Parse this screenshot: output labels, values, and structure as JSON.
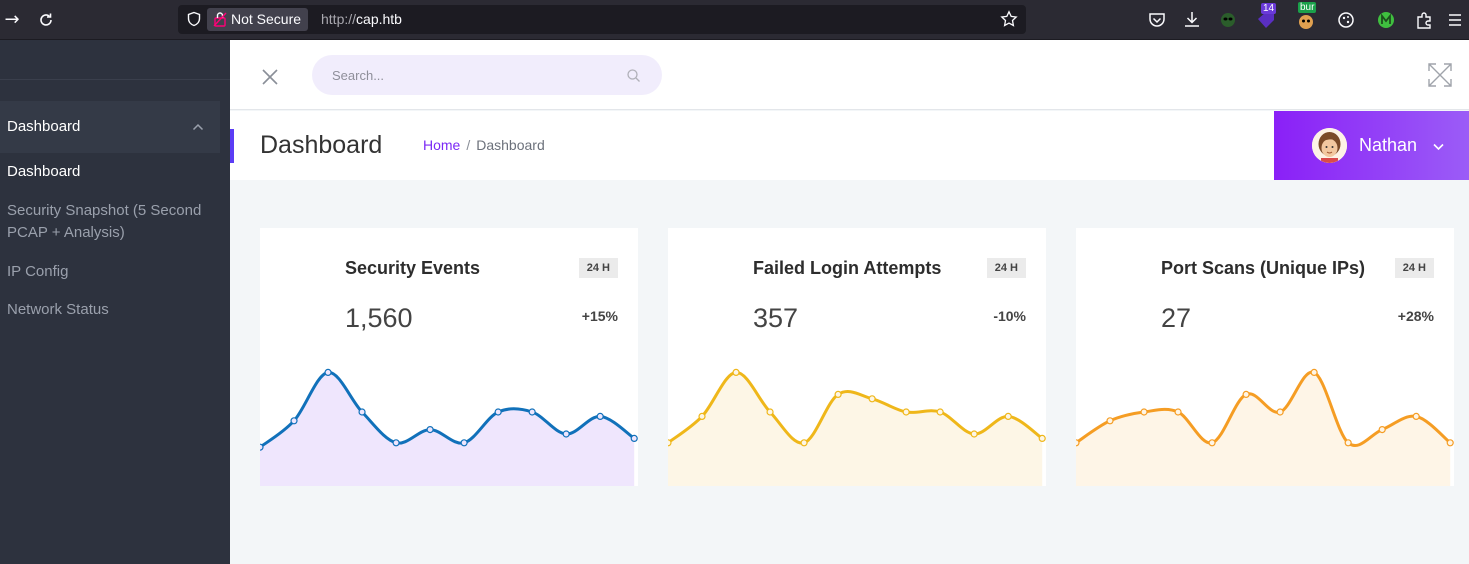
{
  "browser": {
    "not_secure_label": "Not Secure",
    "url_protocol": "http://",
    "url_host": "cap.htb",
    "extension_badge_count": "14",
    "extension_badge_text": "bur"
  },
  "sidebar": {
    "group_label": "Dashboard",
    "items": [
      {
        "label": "Dashboard"
      },
      {
        "label": "Security Snapshot (5 Second PCAP + Analysis)"
      },
      {
        "label": "IP Config"
      },
      {
        "label": "Network Status"
      }
    ]
  },
  "topbar": {
    "search_placeholder": "Search..."
  },
  "header": {
    "title": "Dashboard",
    "breadcrumb_home": "Home",
    "breadcrumb_sep": "/",
    "breadcrumb_current": "Dashboard",
    "user_name": "Nathan"
  },
  "cards": [
    {
      "title": "Security Events",
      "tag": "24 H",
      "value": "1,560",
      "delta": "+15%",
      "color": "#1171ba",
      "fill": "#efe6fd"
    },
    {
      "title": "Failed Login Attempts",
      "tag": "24 H",
      "value": "357",
      "delta": "-10%",
      "color": "#efb71a",
      "fill": "#fdf6e6"
    },
    {
      "title": "Port Scans (Unique IPs)",
      "tag": "24 H",
      "value": "27",
      "delta": "+28%",
      "color": "#f59d24",
      "fill": "#fef5e7"
    }
  ],
  "sparklines": [
    {
      "values": [
        1,
        4,
        9.5,
        5,
        1.5,
        3,
        1.5,
        5,
        5,
        2.5,
        4.5,
        2
      ]
    },
    {
      "values": [
        1.5,
        4.5,
        9.5,
        5,
        1.5,
        7,
        6.5,
        5,
        5,
        2.5,
        4.5,
        2
      ]
    },
    {
      "values": [
        1.5,
        4,
        5,
        5,
        1.5,
        7,
        5,
        9.5,
        1.5,
        3,
        4.5,
        1.5
      ]
    }
  ]
}
